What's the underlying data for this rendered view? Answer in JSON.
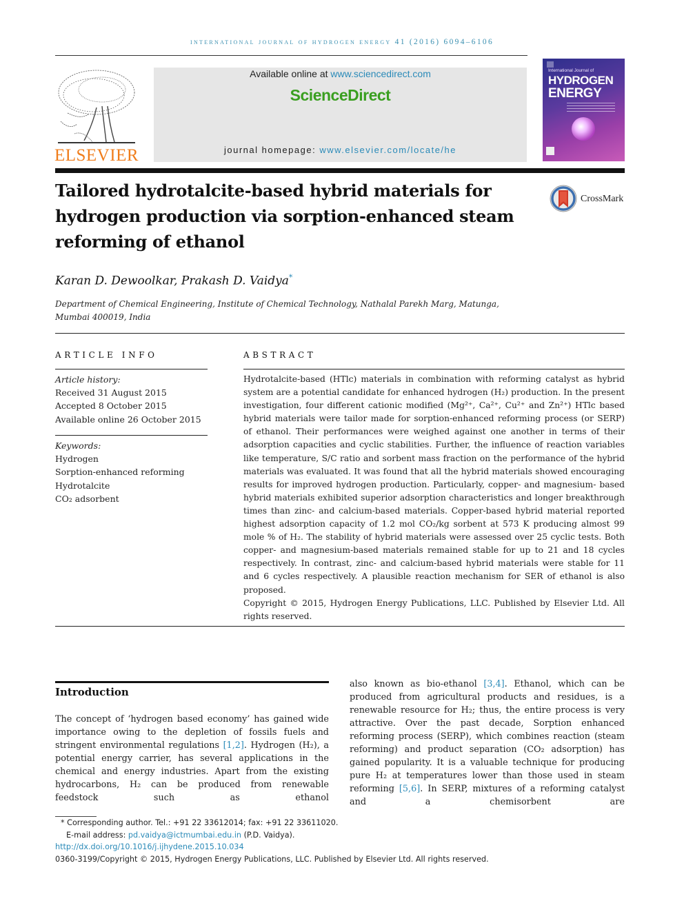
{
  "running_head": "INTERNATIONAL JOURNAL OF HYDROGEN ENERGY 41 (2016) 6094–6106",
  "publisher": {
    "logo_icon": "elsevier-tree-icon",
    "name": "ELSEVIER"
  },
  "sciencedirect_banner": {
    "available_prefix": "Available online at ",
    "available_link": "www.sciencedirect.com",
    "brand": "ScienceDirect",
    "homepage_prefix": "journal homepage: ",
    "homepage_link": "www.elsevier.com/locate/he"
  },
  "journal_cover": {
    "line1": "International Journal of",
    "line2": "HYDROGEN",
    "line3": "ENERGY"
  },
  "crossmark": {
    "icon": "crossmark-icon",
    "label": "CrossMark"
  },
  "article": {
    "title": "Tailored hydrotalcite-based hybrid materials for hydrogen production via sorption-enhanced steam reforming of ethanol",
    "authors": "Karan D. Dewoolkar, Prakash D. Vaidya",
    "corresponding_marker": "*",
    "affiliation": "Department of Chemical Engineering, Institute of Chemical Technology, Nathalal Parekh Marg, Matunga, Mumbai 400019, India"
  },
  "article_info": {
    "heading": "ARTICLE INFO",
    "history_label": "Article history:",
    "history": [
      "Received 31 August 2015",
      "Accepted 8 October 2015",
      "Available online 26 October 2015"
    ],
    "keywords_label": "Keywords:",
    "keywords": [
      "Hydrogen",
      "Sorption-enhanced reforming",
      "Hydrotalcite",
      "CO₂ adsorbent"
    ]
  },
  "abstract": {
    "heading": "ABSTRACT",
    "text": "Hydrotalcite-based (HTlc) materials in combination with reforming catalyst as hybrid system are a potential candidate for enhanced hydrogen (H₂) production. In the present investigation, four different cationic modified (Mg²⁺, Ca²⁺, Cu²⁺ and Zn²⁺) HTlc based hybrid materials were tailor made for sorption-enhanced reforming process (or SERP) of ethanol. Their performances were weighed against one another in terms of their adsorption capacities and cyclic stabilities. Further, the influence of reaction variables like temperature, S/C ratio and sorbent mass fraction on the performance of the hybrid materials was evaluated. It was found that all the hybrid materials showed encouraging results for improved hydrogen production. Particularly, copper- and magnesium- based hybrid materials exhibited superior adsorption characteristics and longer breakthrough times than zinc- and calcium-based materials. Copper-based hybrid material reported highest adsorption capacity of 1.2 mol CO₂/kg sorbent at 573 K producing almost 99 mole % of H₂. The stability of hybrid materials were assessed over 25 cyclic tests. Both copper- and magnesium-based materials remained stable for up to 21 and 18 cycles respectively. In contrast, zinc- and calcium-based hybrid materials were stable for 11 and 6 cycles respectively. A plausible reaction mechanism for SER of ethanol is also proposed.",
    "copyright": "Copyright © 2015, Hydrogen Energy Publications, LLC. Published by Elsevier Ltd. All rights reserved."
  },
  "introduction": {
    "heading": "Introduction",
    "col1": [
      {
        "t": "The concept of ‘hydrogen based economy’ has gained wide importance owing to the depletion of fossils fuels and stringent environmental regulations "
      },
      {
        "ref": "[1,2]"
      },
      {
        "t": ". Hydrogen (H₂), a potential energy carrier, has several applications in the chemical and energy industries. Apart from the existing hydrocarbons, H₂ can be produced from renewable feedstock such as ethanol"
      }
    ],
    "col2": [
      {
        "t": "also known as bio-ethanol "
      },
      {
        "ref": "[3,4]"
      },
      {
        "t": ". Ethanol, which can be produced from agricultural products and residues, is a renewable resource for H₂; thus, the entire process is very attractive. Over the past decade, Sorption enhanced reforming process (SERP), which combines reaction (steam reforming) and product separation (CO₂ adsorption) has gained popularity. It is a valuable technique for producing pure H₂ at temperatures lower than those used in steam reforming "
      },
      {
        "ref": "[5,6]"
      },
      {
        "t": ". In SERP, mixtures of a reforming catalyst and a chemisorbent are"
      }
    ]
  },
  "footnotes": {
    "corresponding": "* Corresponding author. Tel.: +91 22 33612014; fax: +91 22 33611020.",
    "email_prefix": "E-mail address: ",
    "email": "pd.vaidya@ictmumbai.edu.in",
    "email_suffix": " (P.D. Vaidya).",
    "doi": "http://dx.doi.org/10.1016/j.ijhydene.2015.10.034",
    "issn_copyright": "0360-3199/Copyright © 2015, Hydrogen Energy Publications, LLC. Published by Elsevier Ltd. All rights reserved."
  }
}
